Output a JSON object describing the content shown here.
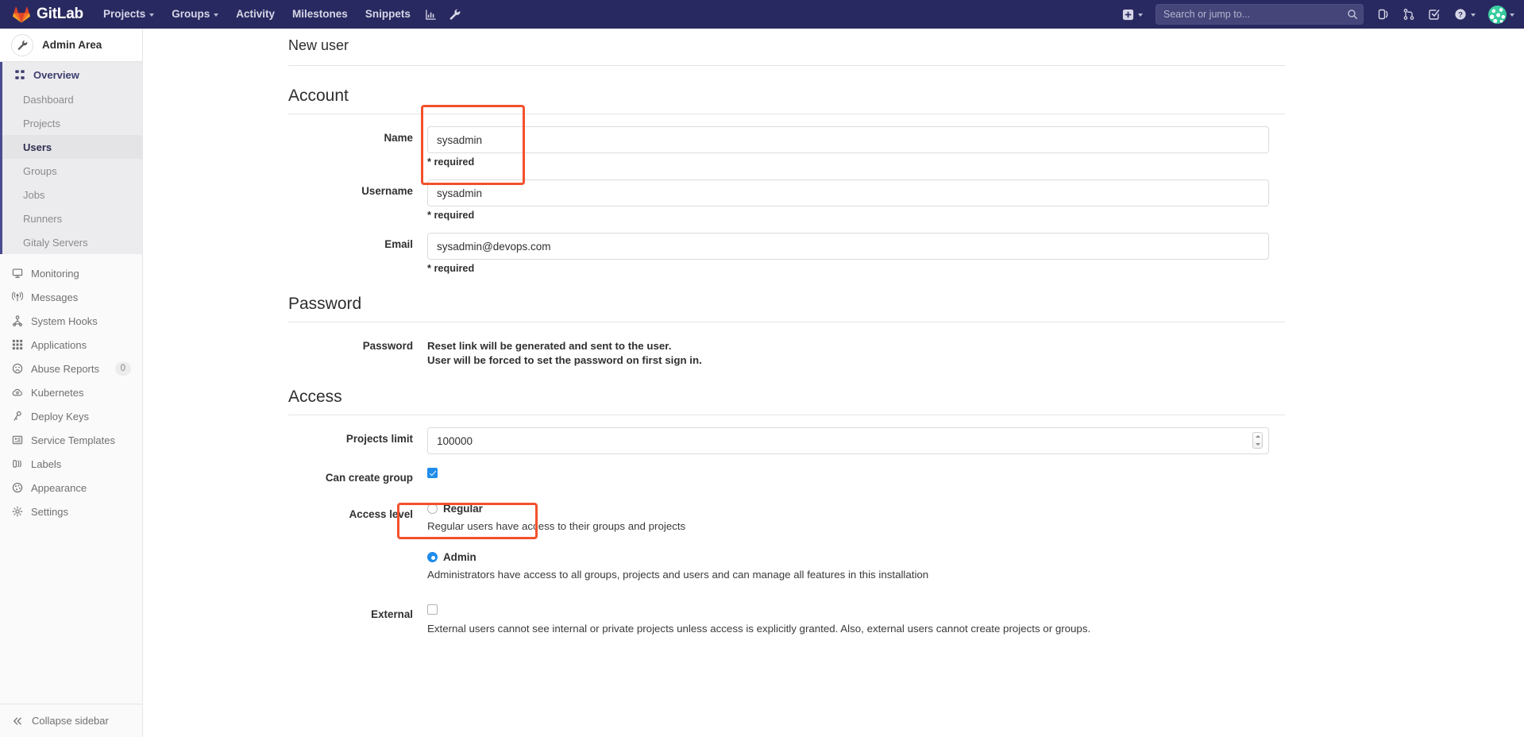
{
  "navbar": {
    "brand": "GitLab",
    "links": [
      {
        "label": "Projects",
        "has_caret": true
      },
      {
        "label": "Groups",
        "has_caret": true
      },
      {
        "label": "Activity",
        "has_caret": false
      },
      {
        "label": "Milestones",
        "has_caret": false
      },
      {
        "label": "Snippets",
        "has_caret": false
      }
    ],
    "icon_buttons": [
      "analytics-icon",
      "wrench-icon"
    ],
    "new_dropdown": "plus-square-icon",
    "search": {
      "placeholder": "Search or jump to...",
      "value": ""
    },
    "right_icons": [
      "todos-icon",
      "merge-requests-icon",
      "issues-icon",
      "help-icon"
    ],
    "avatar": "user-avatar"
  },
  "sidebar": {
    "context_title": "Admin Area",
    "context_icon": "wrench-icon",
    "overview": {
      "label": "Overview",
      "icon": "overview-grid-icon"
    },
    "overview_children": [
      {
        "label": "Dashboard",
        "active": false
      },
      {
        "label": "Projects",
        "active": false
      },
      {
        "label": "Users",
        "active": true
      },
      {
        "label": "Groups",
        "active": false
      },
      {
        "label": "Jobs",
        "active": false
      },
      {
        "label": "Runners",
        "active": false
      },
      {
        "label": "Gitaly Servers",
        "active": false
      }
    ],
    "items": [
      {
        "label": "Monitoring",
        "icon": "monitor-icon",
        "badge": ""
      },
      {
        "label": "Messages",
        "icon": "broadcast-icon",
        "badge": ""
      },
      {
        "label": "System Hooks",
        "icon": "hook-icon",
        "badge": ""
      },
      {
        "label": "Applications",
        "icon": "applications-icon",
        "badge": ""
      },
      {
        "label": "Abuse Reports",
        "icon": "abuse-face-icon",
        "badge": "0"
      },
      {
        "label": "Kubernetes",
        "icon": "kubernetes-cloud-icon",
        "badge": ""
      },
      {
        "label": "Deploy Keys",
        "icon": "key-icon",
        "badge": ""
      },
      {
        "label": "Service Templates",
        "icon": "template-icon",
        "badge": ""
      },
      {
        "label": "Labels",
        "icon": "labels-icon",
        "badge": ""
      },
      {
        "label": "Appearance",
        "icon": "palette-icon",
        "badge": ""
      },
      {
        "label": "Settings",
        "icon": "settings-gear-icon",
        "badge": ""
      }
    ],
    "collapse": {
      "label": "Collapse sidebar",
      "icon": "double-chevron-left-icon"
    }
  },
  "page": {
    "title": "New user",
    "sections": {
      "account": {
        "heading": "Account",
        "name": {
          "label": "Name",
          "value": "sysadmin",
          "help": "* required"
        },
        "username": {
          "label": "Username",
          "value": "sysadmin",
          "help": "* required"
        },
        "email": {
          "label": "Email",
          "value": "sysadmin@devops.com",
          "help": "* required"
        }
      },
      "password": {
        "heading": "Password",
        "label": "Password",
        "line1": "Reset link will be generated and sent to the user.",
        "line2": "User will be forced to set the password on first sign in."
      },
      "access": {
        "heading": "Access",
        "projects_limit": {
          "label": "Projects limit",
          "value": "100000"
        },
        "can_create_group": {
          "label": "Can create group",
          "checked": true
        },
        "access_level": {
          "label": "Access level",
          "options": [
            {
              "label": "Regular",
              "selected": false,
              "description": "Regular users have access to their groups and projects"
            },
            {
              "label": "Admin",
              "selected": true,
              "description": "Administrators have access to all groups, projects and users and can manage all features in this installation"
            }
          ]
        },
        "external": {
          "label": "External",
          "checked": false,
          "description": "External users cannot see internal or private projects unless access is explicitly granted. Also, external users cannot create projects or groups."
        }
      }
    }
  },
  "annotations": {
    "account_box": "highlight-name-username-fields",
    "admin_box": "highlight-admin-access-level"
  },
  "colors": {
    "navbar_bg": "#292961",
    "accent": "#1f8ceb",
    "annotation": "#f4512c",
    "sidebar_bg": "#fafafa"
  }
}
